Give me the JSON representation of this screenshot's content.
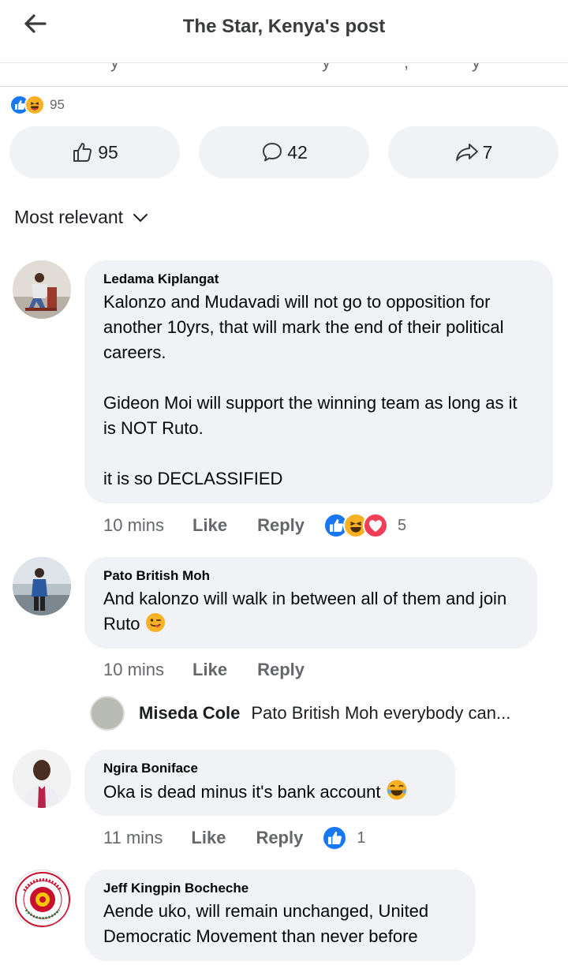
{
  "header": {
    "title": "The Star, Kenya's post"
  },
  "post": {
    "reaction_count": "95",
    "like_count": "95",
    "comment_count": "42",
    "share_count": "7"
  },
  "sort": {
    "label": "Most relevant"
  },
  "comments": [
    {
      "author": "Ledama Kiplangat",
      "text": "Kalonzo and Mudavadi will not go to opposition for another 10yrs, that will mark the end of their political careers.\n\nGideon Moi will support the winning team as long as it is NOT Ruto.\n\nit is so DECLASSIFIED",
      "time": "10 mins",
      "like_label": "Like",
      "reply_label": "Reply",
      "reaction_count": "5"
    },
    {
      "author": "Pato British Moh",
      "text": "And kalonzo will walk in  between all of them and join Ruto",
      "time": "10 mins",
      "like_label": "Like",
      "reply_label": "Reply",
      "reply_preview": {
        "author": "Miseda Cole",
        "text": "Pato British Moh everybody can..."
      }
    },
    {
      "author": "Ngira Boniface",
      "text": "Oka is dead minus it's bank account",
      "time": "11 mins",
      "like_label": "Like",
      "reply_label": "Reply",
      "reaction_count": "1"
    },
    {
      "author": "Jeff Kingpin Bocheche",
      "text": "Aende uko, will remain unchanged, United Democratic Movement than never before",
      "avatar_logo_text": "KENYANS FOR RUTO"
    }
  ],
  "colors": {
    "accent": "#1877f2",
    "bubble": "#f0f2f5",
    "meta_text": "#65676b"
  }
}
